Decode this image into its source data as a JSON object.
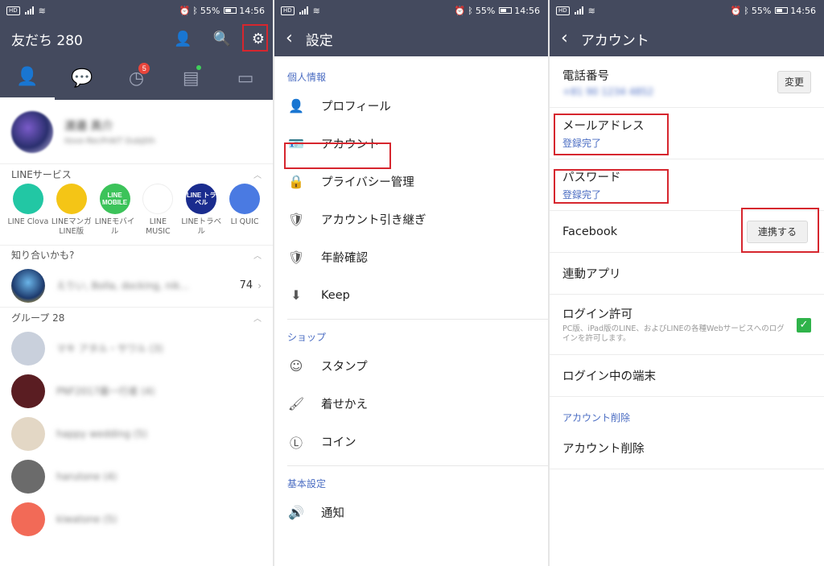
{
  "status": {
    "battery": "55%",
    "time": "14:56"
  },
  "panel1": {
    "title": "友だち 280",
    "tab_badge": "5",
    "profile": {
      "name": "渡邉 真介",
      "status": "Ilove-RecPrAtT Dubjtth"
    },
    "services_label": "LINEサービス",
    "services": [
      {
        "icon": "",
        "label": "LINE Clova",
        "color": "#22c7a4"
      },
      {
        "icon": "",
        "label": "LINEマンガ LINE版",
        "color": "#f4c516"
      },
      {
        "icon": "LINE MOBILE",
        "label": "LINEモバイル",
        "color": "#3cc35a"
      },
      {
        "icon": "",
        "label": "LINE MUSIC",
        "color": "#ffffff"
      },
      {
        "icon": "LINE トラベル",
        "label": "LINEトラベル",
        "color": "#1a2c8e"
      },
      {
        "icon": "",
        "label": "LI QUIC",
        "color": "#4a7ae2"
      }
    ],
    "suggest_label": "知り合いかも?",
    "suggest": {
      "name": "えりい, Bolla, docking, nik...",
      "count": "74"
    },
    "groups_label": "グループ 28",
    "groups": [
      {
        "name": "マキ アタル・サワル (3)",
        "color": "#c9d0dc"
      },
      {
        "name": "PNF2017最一行者 (4)",
        "color": "#5a1d22"
      },
      {
        "name": "happy wedding (5)",
        "color": "#e3d7c5"
      },
      {
        "name": "harutone (4)",
        "color": "#6b6b6b"
      },
      {
        "name": "kiwatone (5)",
        "color": "#f26a57"
      }
    ]
  },
  "panel2": {
    "title": "設定",
    "sections": [
      {
        "label": "個人情報",
        "items": [
          {
            "icon": "👤",
            "label": "プロフィール"
          },
          {
            "icon": "🪪",
            "label": "アカウント"
          },
          {
            "icon": "🔒",
            "label": "プライバシー管理"
          },
          {
            "icon": "🛡",
            "label": "アカウント引き継ぎ"
          },
          {
            "icon": "🛡",
            "label": "年齢確認"
          },
          {
            "icon": "⬇",
            "label": "Keep"
          }
        ]
      },
      {
        "label": "ショップ",
        "items": [
          {
            "icon": "☺",
            "label": "スタンプ"
          },
          {
            "icon": "🖌",
            "label": "着せかえ"
          },
          {
            "icon": "Ⓛ",
            "label": "コイン"
          }
        ]
      },
      {
        "label": "基本設定",
        "items": [
          {
            "icon": "🔊",
            "label": "通知"
          }
        ]
      }
    ]
  },
  "panel3": {
    "title": "アカウント",
    "phone_label": "電話番号",
    "phone_value": "+81 90 1234 4852",
    "phone_button": "変更",
    "email_label": "メールアドレス",
    "email_value": "登録完了",
    "password_label": "パスワード",
    "password_value": "登録完了",
    "facebook_label": "Facebook",
    "facebook_button": "連携する",
    "apps_label": "連動アプリ",
    "login_label": "ログイン許可",
    "login_desc": "PC版、iPad版のLINE、およびLINEの各種Webサービスへのログインを許可します。",
    "devices_label": "ログイン中の端末",
    "delete_section": "アカウント削除",
    "delete_label": "アカウント削除"
  }
}
